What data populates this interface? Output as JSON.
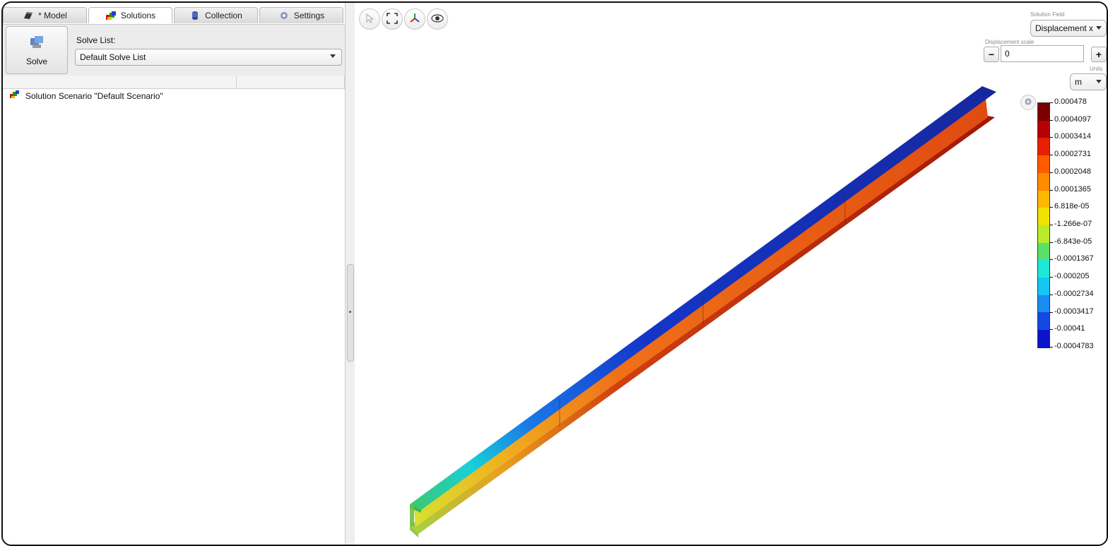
{
  "tabs": [
    {
      "label": "* Model",
      "icon": "model-icon"
    },
    {
      "label": "Solutions",
      "icon": "solutions-icon"
    },
    {
      "label": "Collection",
      "icon": "collection-icon"
    },
    {
      "label": "Settings",
      "icon": "gear-icon"
    }
  ],
  "toolbar": {
    "solve_label": "Solve",
    "solve_list_label": "Solve List:",
    "solve_list_value": "Default Solve List"
  },
  "tree": {
    "items": [
      {
        "label": "Solution Scenario \"Default Scenario\"",
        "icon": "scenario-icon"
      }
    ]
  },
  "viewport": {
    "toolbar_icons": [
      "select-icon",
      "fit-view-icon",
      "axes-icon",
      "eye-icon"
    ],
    "solution_field_caption": "Solution Field",
    "solution_field_value": "Displacement x",
    "displacement_scale_caption": "Displacement scale",
    "displacement_scale_value": "0",
    "minus_label": "−",
    "plus_label": "+",
    "units_caption": "Units",
    "units_value": "m",
    "legend": {
      "labels": [
        "0.000478",
        "0.0004097",
        "0.0003414",
        "0.0002731",
        "0.0002048",
        "0.0001365",
        "6.818e-05",
        "-1.266e-07",
        "-6.843e-05",
        "-0.0001367",
        "-0.000205",
        "-0.0002734",
        "-0.0003417",
        "-0.00041",
        "-0.0004783"
      ],
      "colors": [
        "#7a0000",
        "#b40000",
        "#e62000",
        "#ff5a00",
        "#ff8c00",
        "#ffb800",
        "#f2e000",
        "#b8ec2a",
        "#58e06a",
        "#1ee8d8",
        "#16c6f4",
        "#1a8cf0",
        "#1448e0",
        "#0a14c8"
      ]
    }
  }
}
